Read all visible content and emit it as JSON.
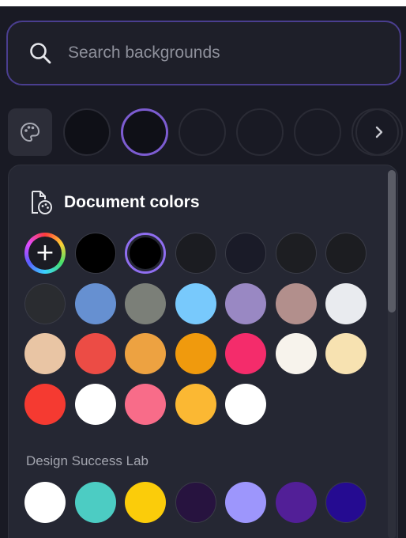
{
  "search": {
    "placeholder": "Search backgrounds"
  },
  "recent_backgrounds": [
    "#0f1017",
    "#0f1017",
    "#191a24",
    "#191a24",
    "#191a24",
    "#191a24"
  ],
  "document_colors": {
    "title": "Document colors",
    "add_label": "+",
    "swatches": [
      "#000000",
      "#000000",
      "#1b1c21",
      "#1a1b28",
      "#1d1e22",
      "#1c1d21",
      "#2a2c30",
      "#6690d1",
      "#7b7f78",
      "#78c9fc",
      "#9988c3",
      "#b28f8c",
      "#e9ebef",
      "#e9c5a4",
      "#ec4c45",
      "#eda241",
      "#f09a0d",
      "#f42c6b",
      "#f7f3ec",
      "#f7e2b1",
      "#f53a31",
      "#ffffff",
      "#f86c89",
      "#fbb833",
      "#ffffff"
    ],
    "selected_index": 1
  },
  "brand_kit": {
    "name": "Design Success Lab",
    "swatches": [
      "#ffffff",
      "#4cccc3",
      "#fbcc0a",
      "#27133f",
      "#9d96fc",
      "#521f97",
      "#250b91"
    ]
  }
}
